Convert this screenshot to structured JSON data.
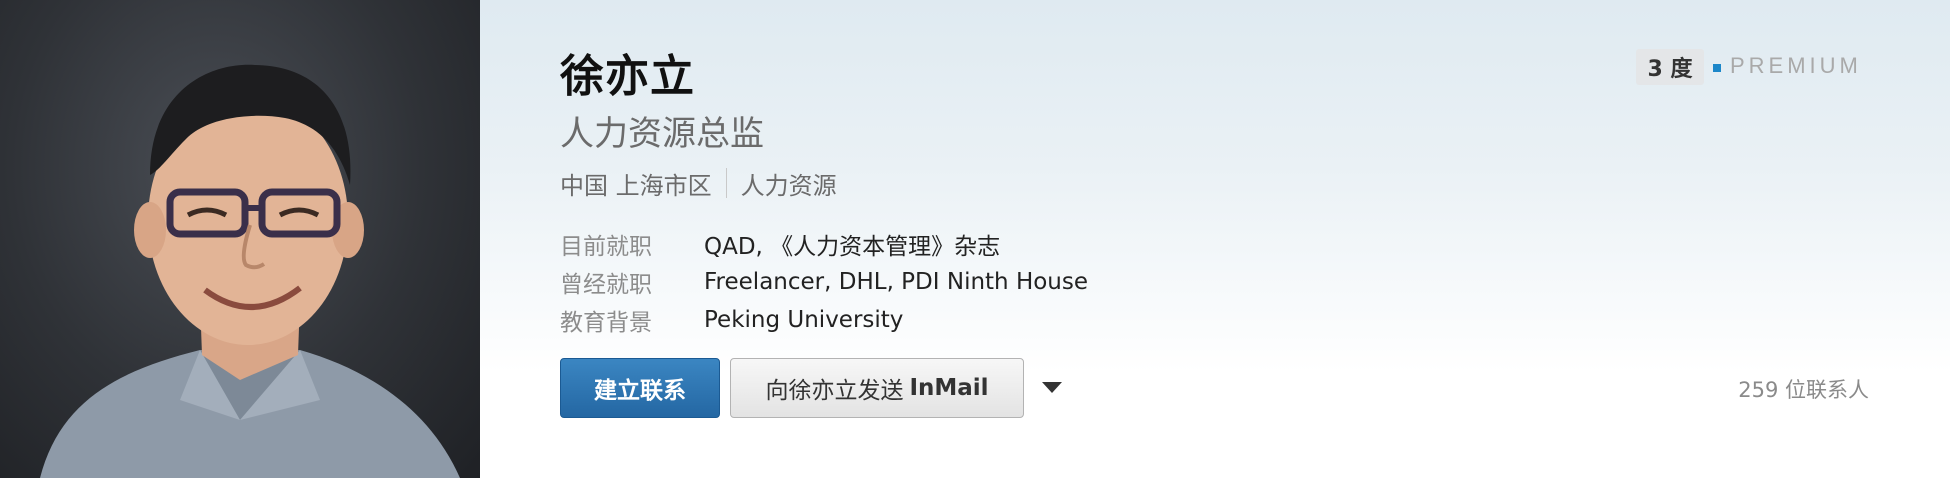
{
  "profile": {
    "name": "徐亦立",
    "headline": "人力资源总监",
    "location": "中国 上海市区",
    "industry": "人力资源",
    "rows": [
      {
        "label": "目前就职",
        "value": "QAD, 《人力资本管理》杂志"
      },
      {
        "label": "曾经就职",
        "value": "Freelancer, DHL, PDI Ninth House"
      },
      {
        "label": "教育背景",
        "value": "Peking University"
      }
    ]
  },
  "badges": {
    "degree": "3 度",
    "premium": "PREMIUM"
  },
  "actions": {
    "connect_label": "建立联系",
    "inmail_prefix": "向徐亦立发送",
    "inmail_suffix": "InMail",
    "more_icon": "caret-down-icon"
  },
  "connections": "259 位联系人",
  "colors": {
    "primary_button": "#2467a3",
    "premium_accent": "#1c87c9"
  }
}
